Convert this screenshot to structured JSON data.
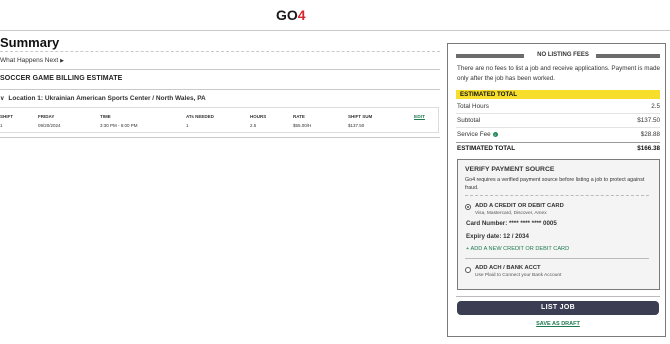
{
  "header": {
    "logo_main": "GO",
    "logo_accent": "4"
  },
  "summary": {
    "title": "Summary",
    "what_next": "What Happens Next",
    "estimate_title": "SOCCER GAME BILLING ESTIMATE",
    "location_label": "Location 1:",
    "location_value": "Ukrainian American Sports Center / North Wales, PA",
    "table": {
      "headers": [
        "SHIFT",
        "FRIDAY",
        "TIME",
        "ATs NEEDED",
        "HOURS",
        "RATE",
        "SHIFT SUM"
      ],
      "row": [
        "1",
        "09/20/2024",
        "3:30 PM - 6:00 PM",
        "1",
        "2.5",
        "$55.00/H",
        "$137.50"
      ],
      "edit": "EDIT"
    }
  },
  "sidebar": {
    "no_listing_title": "NO LISTING FEES",
    "no_listing_text": "There are no fees to list a job and receive applications. Payment is made only after the job has been worked.",
    "estimated_total_header": "ESTIMATED TOTAL",
    "rows": {
      "total_hours_label": "Total Hours",
      "total_hours": "2.5",
      "subtotal_label": "Subtotal",
      "subtotal": "$137.50",
      "service_fee_label": "Service Fee",
      "service_fee": "$28.88",
      "estimated_total_label": "ESTIMATED TOTAL",
      "estimated_total": "$166.38"
    },
    "verify": {
      "title": "VERIFY PAYMENT SOURCE",
      "text": "Go4 requires a verified payment source before listing a job to protect against fraud.",
      "card_option_title": "ADD A CREDIT OR DEBIT CARD",
      "card_option_sub": "Visa, Mastercard, Discover, Amex",
      "card_number": "Card Number: **** **** **** 0005",
      "expiry": "Expiry date: 12 / 2034",
      "add_new": "+ ADD A NEW CREDIT OR DEBIT CARD",
      "ach_title": "ADD ACH / BANK ACCT",
      "ach_sub": "Use Plaid to Connect your Bank Account"
    },
    "list_job": "LIST JOB",
    "save_draft": "SAVE AS DRAFT"
  }
}
